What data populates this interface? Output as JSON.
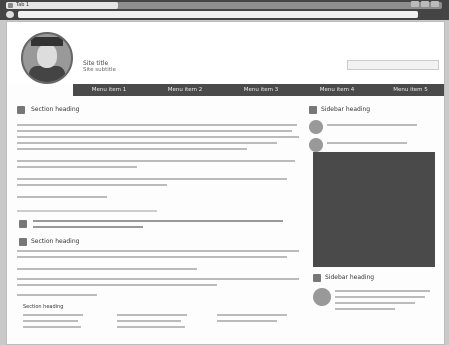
{
  "browser": {
    "active_tab_title": "Tab 1"
  },
  "site": {
    "title": "Site title",
    "subtitle": "Site subtitle"
  },
  "menu": [
    "Menu item 1",
    "Menu item 2",
    "Menu item 3",
    "Menu item 4",
    "Menu item 5"
  ],
  "main": {
    "section1_title": "Section heading",
    "section2_title": "Section heading",
    "section3_title": "Section heading"
  },
  "sidebar": {
    "title1": "Sidebar heading",
    "title2": "Sidebar heading"
  }
}
